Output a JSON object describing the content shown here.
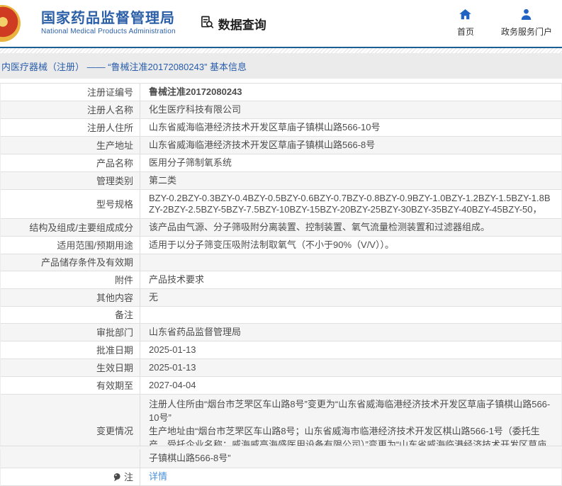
{
  "header": {
    "title": "国家药品监督管理局",
    "subtitle": "National Medical Products Administration",
    "section_label": "数据查询",
    "nav": [
      {
        "label": "首页",
        "icon": "home-icon"
      },
      {
        "label": "政务服务门户",
        "icon": "user-icon"
      }
    ]
  },
  "breadcrumb": "内医疗器械（注册） —— “鲁械注准20172080243” 基本信息",
  "colors": {
    "brand_blue": "#2b5fa7",
    "nav_icon_blue": "#2163c3",
    "header_rule_blue": "#1d5e92",
    "link_blue": "#4a90d9",
    "zebra_gray": "#f5f5f5",
    "breadcrumb_bg": "#ebebeb"
  },
  "icons": {
    "logo": "national-emblem",
    "section": "document-search-icon",
    "note_row": "note-balloon-icon"
  },
  "table": {
    "rows": [
      {
        "label": "注册证编号",
        "value": "鲁械注准20172080243",
        "bold": true
      },
      {
        "label": "注册人名称",
        "value": "化生医疗科技有限公司"
      },
      {
        "label": "注册人住所",
        "value": "山东省威海临港经济技术开发区草庙子镇棋山路566-10号"
      },
      {
        "label": "生产地址",
        "value": "山东省威海临港经济技术开发区草庙子镇棋山路566-8号"
      },
      {
        "label": "产品名称",
        "value": "医用分子筛制氧系统"
      },
      {
        "label": "管理类别",
        "value": "第二类"
      },
      {
        "label": "型号规格",
        "value": "BZY-0.2BZY-0.3BZY-0.4BZY-0.5BZY-0.6BZY-0.7BZY-0.8BZY-0.9BZY-1.0BZY-1.2BZY-1.5BZY-1.8BZY-2BZY-2.5BZY-5BZY-7.5BZY-10BZY-15BZY-20BZY-25BZY-30BZY-35BZY-40BZY-45BZY-50，"
      },
      {
        "label": "结构及组成/主要组成成分",
        "value": "该产品由气源、分子筛吸附分离装置、控制装置、氧气流量检测装置和过滤器组成。"
      },
      {
        "label": "适用范围/预期用途",
        "value": "适用于以分子筛变压吸附法制取氧气（不小于90%（V/V））。"
      },
      {
        "label": "产品储存条件及有效期",
        "value": ""
      },
      {
        "label": "附件",
        "value": "产品技术要求"
      },
      {
        "label": "其他内容",
        "value": "无"
      },
      {
        "label": "备注",
        "value": ""
      },
      {
        "label": "审批部门",
        "value": "山东省药品监督管理局"
      },
      {
        "label": "批准日期",
        "value": "2025-01-13"
      },
      {
        "label": "生效日期",
        "value": "2025-01-13"
      },
      {
        "label": "有效期至",
        "value": "2027-04-04"
      },
      {
        "label": "变更情况",
        "lines": [
          "注册人住所由“烟台市芝罘区车山路8号”变更为“山东省威海临港经济技术开发区草庙子镇棋山路566-10号”",
          "生产地址由“烟台市芝罘区车山路8号；山东省威海市临港经济技术开发区棋山路566-1号（委托生产，受托企业名称：威海威高海盛医用设备有限公司）”变更为“山东省威海临港经济技术开发区草庙子镇棋山路566-8号”"
        ]
      },
      {
        "label": "注",
        "value": "详情",
        "link": true,
        "icon": "note-balloon"
      }
    ]
  }
}
